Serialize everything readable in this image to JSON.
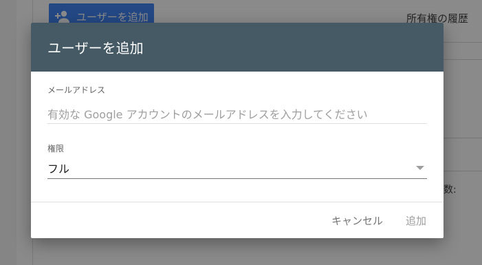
{
  "background": {
    "add_user_button_label": "ユーザーを追加",
    "ownership_history_label": "所有権の履歴",
    "rows_label": "の行数:"
  },
  "dialog": {
    "title": "ユーザーを追加",
    "email": {
      "label": "メールアドレス",
      "placeholder": "有効な Google アカウントのメールアドレスを入力してください",
      "value": ""
    },
    "permission": {
      "label": "権限",
      "selected": "フル"
    },
    "buttons": {
      "cancel": "キャンセル",
      "add": "追加"
    }
  },
  "colors": {
    "header_bg": "#455a64",
    "primary_button": "#4285f4"
  },
  "icons": {
    "add_user": "person-add-icon",
    "dropdown": "dropdown-arrow-icon"
  }
}
